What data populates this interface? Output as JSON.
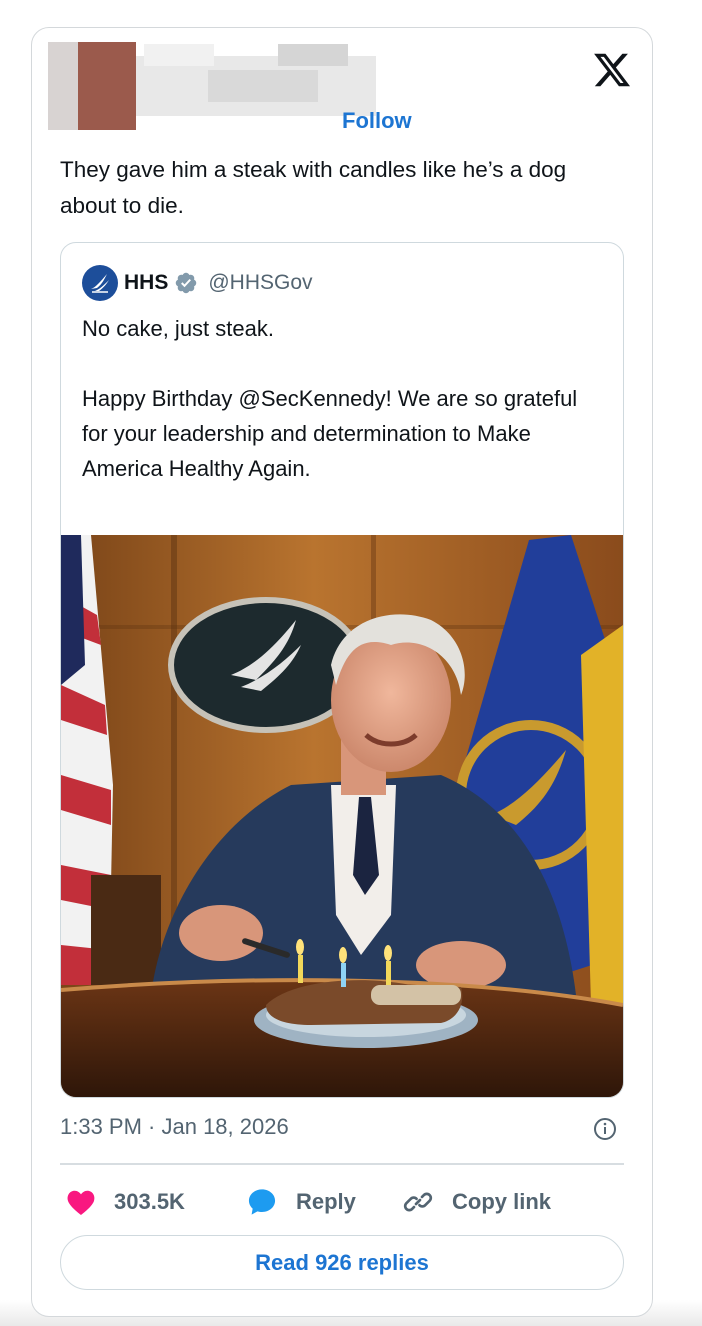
{
  "author": {
    "follow_label": "Follow"
  },
  "post": {
    "text": "They gave him a steak with candles like he’s a dog about to die.",
    "timestamp": "1:33 PM · Jan 18, 2026"
  },
  "quoted_post": {
    "display_name": "HHS",
    "handle": "@HHSGov",
    "paragraph_1": "No cake, just steak.",
    "paragraph_2": "Happy Birthday @SecKennedy! We are so grateful for your leadership and determination to Make America Healthy Again."
  },
  "actions": {
    "likes_count": "303.5K",
    "reply_label": "Reply",
    "copy_link_label": "Copy link",
    "read_replies_label": "Read 926 replies"
  },
  "colors": {
    "link_blue": "#1d75d2",
    "like_pink": "#f91880",
    "reply_blue": "#1d9bf0",
    "verified_gray": "#829aab",
    "text_secondary": "#536471"
  },
  "icons": [
    "x-logo-icon",
    "hhs-eagle-icon",
    "verified-badge-icon",
    "info-icon",
    "heart-icon",
    "reply-bubble-icon",
    "link-icon"
  ]
}
